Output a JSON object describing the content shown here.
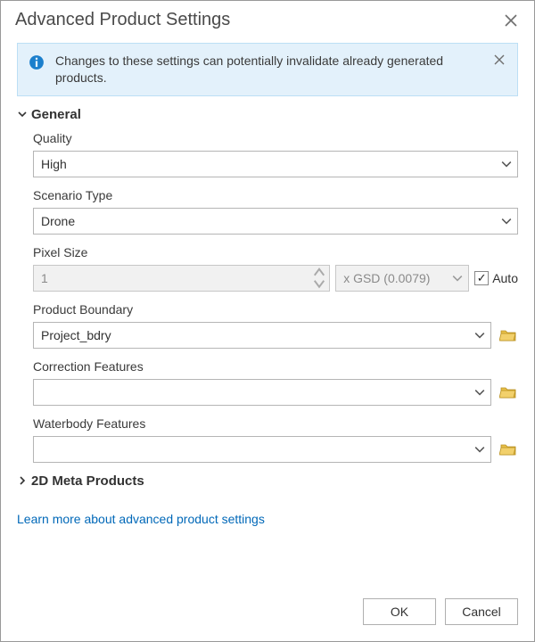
{
  "dialog": {
    "title": "Advanced Product Settings"
  },
  "alert": {
    "message": "Changes to these settings can potentially invalidate already generated products."
  },
  "sections": {
    "general": {
      "title": "General",
      "expanded": true,
      "fields": {
        "quality": {
          "label": "Quality",
          "value": "High"
        },
        "scenario_type": {
          "label": "Scenario Type",
          "value": "Drone"
        },
        "pixel_size": {
          "label": "Pixel Size",
          "value": "1",
          "unit": "x GSD (0.0079)",
          "auto_label": "Auto",
          "auto_checked": true
        },
        "product_boundary": {
          "label": "Product Boundary",
          "value": "Project_bdry"
        },
        "correction_features": {
          "label": "Correction Features",
          "value": ""
        },
        "waterbody_features": {
          "label": "Waterbody Features",
          "value": ""
        }
      }
    },
    "meta_2d": {
      "title": "2D Meta Products",
      "expanded": false
    }
  },
  "link": {
    "text": "Learn more about advanced product settings"
  },
  "buttons": {
    "ok": "OK",
    "cancel": "Cancel"
  }
}
